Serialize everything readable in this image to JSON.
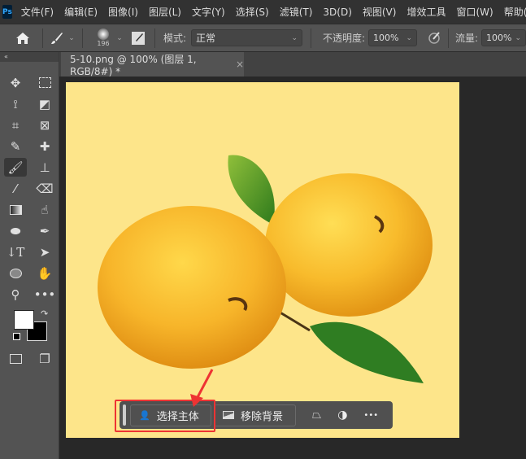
{
  "app": {
    "logo": "Ps"
  },
  "menu": [
    "文件(F)",
    "编辑(E)",
    "图像(I)",
    "图层(L)",
    "文字(Y)",
    "选择(S)",
    "滤镜(T)",
    "3D(D)",
    "视图(V)",
    "增效工具",
    "窗口(W)",
    "帮助(H)"
  ],
  "options": {
    "brush_size": "196",
    "mode_label": "模式:",
    "mode_value": "正常",
    "opacity_label": "不透明度:",
    "opacity_value": "100%",
    "flow_label": "流量:",
    "flow_value": "100%"
  },
  "toolbar": {
    "collapse": "«"
  },
  "document": {
    "tab_title": "5-10.png @ 100% (图层 1, RGB/8#) *",
    "close": "×",
    "background": "#fde58a"
  },
  "context_bar": {
    "select_subject": "选择主体",
    "remove_background": "移除背景",
    "more": "•••"
  },
  "colors": {
    "foreground": "#ffffff",
    "background": "#000000",
    "highlight": "#e53333"
  }
}
